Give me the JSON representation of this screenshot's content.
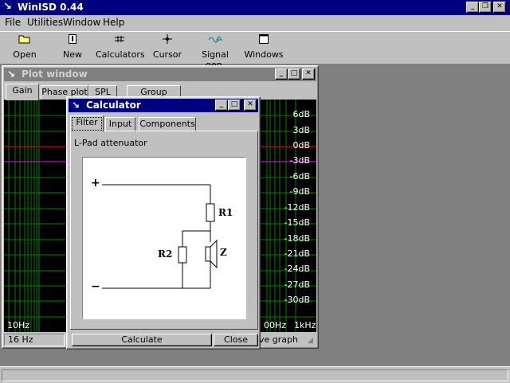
{
  "app": {
    "title": "WinISD 0.44",
    "icon": "winisd-icon"
  },
  "menu": [
    "File",
    "Utilities",
    "Window",
    "Help"
  ],
  "toolbar": [
    {
      "label": "Open",
      "icon": "folder-open-icon"
    },
    {
      "label": "New",
      "icon": "new-document-icon"
    },
    {
      "label": "Calculators",
      "icon": "calculator-icon"
    },
    {
      "label": "Cursor",
      "icon": "crosshair-icon"
    },
    {
      "label": "Signal gen.",
      "icon": "signal-generator-icon"
    },
    {
      "label": "Windows",
      "icon": "windows-icon"
    }
  ],
  "plot_window": {
    "title": "Plot window",
    "tabs": [
      "Gain",
      "Phase plot",
      "SPL",
      "Group delay"
    ],
    "y_labels": [
      "6dB",
      "3dB",
      "0dB",
      "-3dB",
      "-6dB",
      "-9dB",
      "-12dB",
      "-15dB",
      "-18dB",
      "-21dB",
      "-24dB",
      "-27dB",
      "-30dB"
    ],
    "x_label_left": "10Hz",
    "x_label_right_partial": "00Hz",
    "x_label_right": "1kHz",
    "status_left": "16 Hz",
    "status_right_partial": "ve graph",
    "colors": {
      "background": "#000000",
      "grid": "#008000",
      "zero_line": "#ff0000",
      "curve": "#ff00ff"
    }
  },
  "calculator": {
    "title": "Calculator",
    "tabs": [
      "Filter",
      "Input",
      "Components"
    ],
    "heading": "L-Pad attenuator",
    "diagram": {
      "plus": "+",
      "minus": "−",
      "r1": "R1",
      "r2": "R2",
      "z": "Z"
    },
    "buttons": {
      "calculate": "Calculate",
      "close": "Close"
    }
  }
}
